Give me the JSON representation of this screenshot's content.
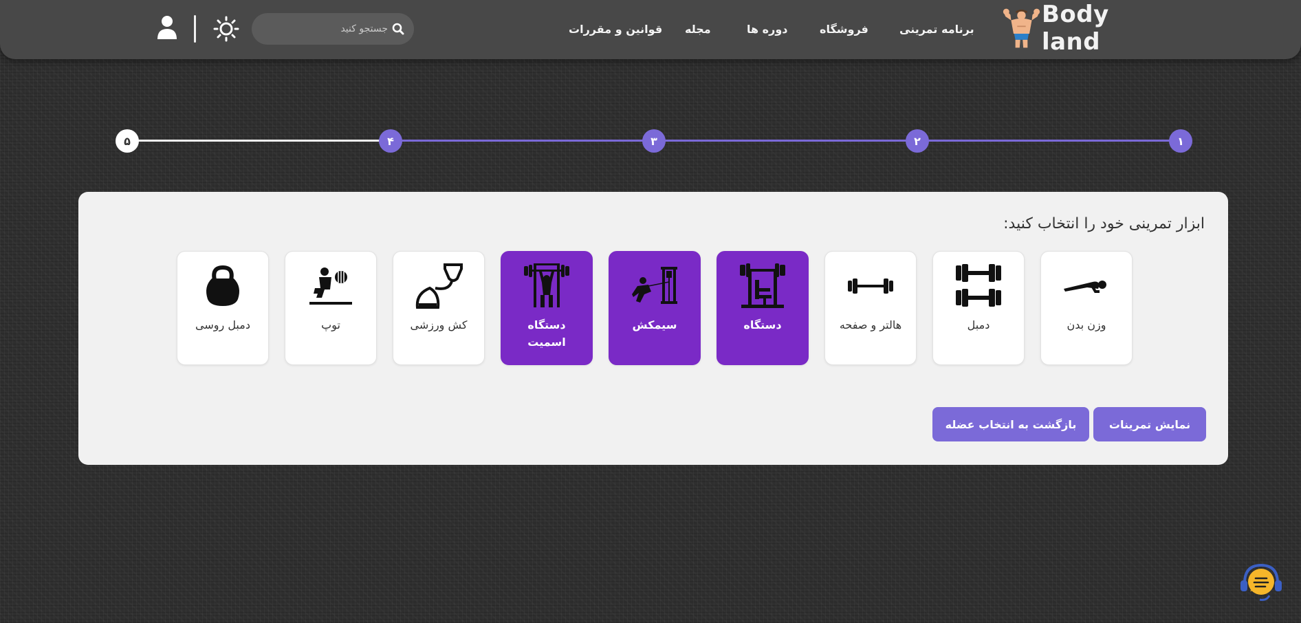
{
  "header": {
    "logo_text": "Body land",
    "nav": [
      {
        "label": "برنامه تمرینی"
      },
      {
        "label": "فروشگاه"
      },
      {
        "label": "دوره ها"
      },
      {
        "label": "مجله"
      },
      {
        "label": "قوانین و مقررات"
      }
    ],
    "search": {
      "placeholder": "جستجو کنید",
      "icon": "search-icon"
    },
    "theme_icon": "sun-icon",
    "user_icon": "user-icon"
  },
  "stepper": {
    "steps": [
      "۱",
      "۲",
      "۳",
      "۴",
      "۵"
    ],
    "current_step": 4,
    "total_steps": 5
  },
  "card": {
    "title": "ابزار تمرینی خود را انتخاب کنید:",
    "equipment": [
      {
        "label": "وزن بدن",
        "icon": "plank-icon",
        "selected": false
      },
      {
        "label": "دمبل",
        "icon": "dumbbells-icon",
        "selected": false
      },
      {
        "label": "هالتر و صفحه",
        "icon": "barbell-icon",
        "selected": false
      },
      {
        "label": "دستگاه",
        "icon": "machine-icon",
        "selected": true
      },
      {
        "label": "سیمکش",
        "icon": "cable-icon",
        "selected": true
      },
      {
        "label": "دستگاه اسمیت",
        "icon": "smith-machine-icon",
        "selected": true
      },
      {
        "label": "کش ورزشی",
        "icon": "resistance-band-icon",
        "selected": false
      },
      {
        "label": "توپ",
        "icon": "ball-icon",
        "selected": false
      },
      {
        "label": "دمبل روسی",
        "icon": "kettlebell-icon",
        "selected": false
      }
    ],
    "show_exercises_label": "نمایش تمرینات",
    "back_label": "بازگشت به انتخاب عضله"
  },
  "chat_icon": "chat-icon",
  "colors": {
    "accent": "#7b6ad8",
    "selected_tile": "#7a2ac6",
    "header_bg": "#484848",
    "card_bg": "#f1f1f1"
  }
}
